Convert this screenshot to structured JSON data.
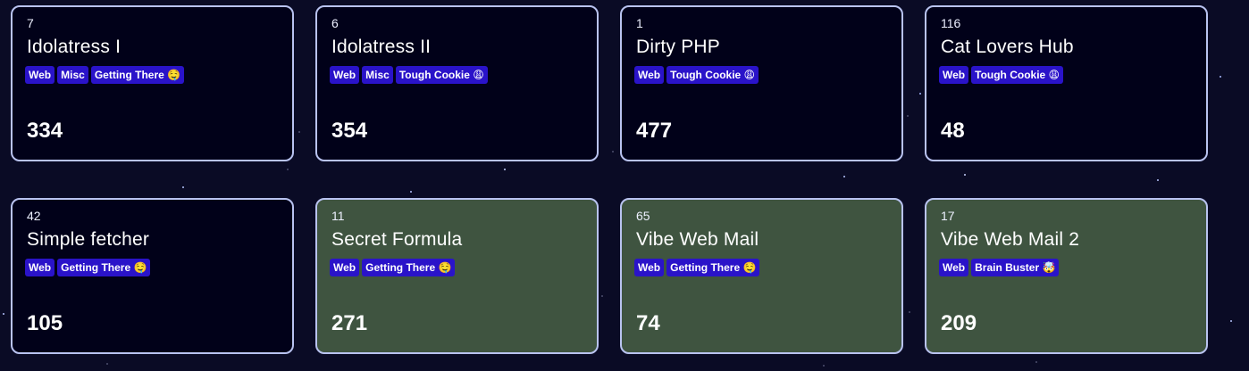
{
  "challenges": [
    {
      "id": "7",
      "title": "Idolatress I",
      "tags": [
        "Web",
        "Misc",
        "Getting There 🤤"
      ],
      "points": "334",
      "solved": false
    },
    {
      "id": "6",
      "title": "Idolatress II",
      "tags": [
        "Web",
        "Misc",
        "Tough Cookie 😩"
      ],
      "points": "354",
      "solved": false
    },
    {
      "id": "1",
      "title": "Dirty PHP",
      "tags": [
        "Web",
        "Tough Cookie 😩"
      ],
      "points": "477",
      "solved": false
    },
    {
      "id": "116",
      "title": "Cat Lovers Hub",
      "tags": [
        "Web",
        "Tough Cookie 😩"
      ],
      "points": "48",
      "solved": false
    },
    {
      "id": "42",
      "title": "Simple fetcher",
      "tags": [
        "Web",
        "Getting There 🤤"
      ],
      "points": "105",
      "solved": false
    },
    {
      "id": "11",
      "title": "Secret Formula",
      "tags": [
        "Web",
        "Getting There 🤤"
      ],
      "points": "271",
      "solved": true
    },
    {
      "id": "65",
      "title": "Vibe Web Mail",
      "tags": [
        "Web",
        "Getting There 🤤"
      ],
      "points": "74",
      "solved": true
    },
    {
      "id": "17",
      "title": "Vibe Web Mail 2",
      "tags": [
        "Web",
        "Brain Buster 🤯"
      ],
      "points": "209",
      "solved": true
    }
  ],
  "colors": {
    "background": "#0a0b25",
    "card_background": "#010119",
    "card_solved_background": "#3f5440",
    "card_border": "#b9c3f0",
    "tag_background": "#2a13c9"
  }
}
